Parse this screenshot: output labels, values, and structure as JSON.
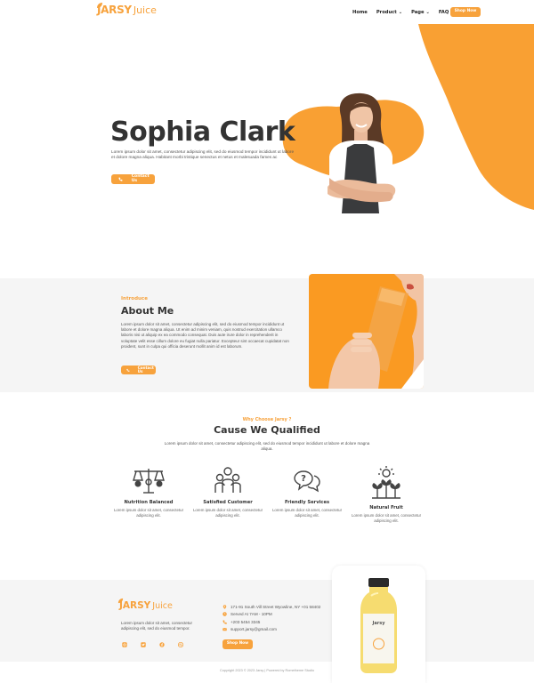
{
  "header": {
    "logo_bold": "JARSY",
    "logo_light": "Juice",
    "nav": [
      {
        "label": "Home",
        "dropdown": false
      },
      {
        "label": "Product",
        "dropdown": true
      },
      {
        "label": "Page",
        "dropdown": true
      },
      {
        "label": "FAQ",
        "dropdown": false
      }
    ],
    "shop_label": "Shop Now"
  },
  "hero": {
    "name": "Sophia Clark",
    "description": "Lorem ipsum dolor sit amet, consectetur adipiscing elit, sed do eiusmod tempor incididunt ut labore et dolore magna aliqua. Habitant morbi tristique senectus et netus et malesuada fames ac",
    "button_label": "Contact Us"
  },
  "about": {
    "label": "Introduce",
    "title": "About Me",
    "text": "Lorem ipsum dolor sit amet, consectetur adipiscing elit, sed do eiusmod tempor incididunt ut labore et dolore magna aliqua. Ut enim ad minim veniam, quis nostrud exercitation ullamco laboris nisi ut aliquip ex ea commodo consequat. Duis aute irure dolor in reprehenderit in voluptate velit esse cillum dolore eu fugiat nulla pariatur. Excepteur sint occaecat cupidatat non proident, sunt in culpa qui officia deserunt mollit anim id est laborum.",
    "button_label": "Contact Us"
  },
  "why": {
    "label": "Why Choose Jarsy ?",
    "title": "Cause We Qualified",
    "description": "Lorem ipsum dolor sit amet, consectetur adipiscing elit, sed do eiusmod tempor incididunt ut labore et dolore magna aliqua.",
    "features": [
      {
        "title": "Nutrition Balanced",
        "text": "Lorem ipsum dolor sit amet, consectetur adipiscing elit.",
        "icon": "nutrition-balance-icon"
      },
      {
        "title": "Satisfied Customer",
        "text": "Lorem ipsum dolor sit amet, consectetur adipiscing elit.",
        "icon": "satisfied-customer-icon"
      },
      {
        "title": "Friendly Services",
        "text": "Lorem ipsum dolor sit amet, consectetur adipiscing elit.",
        "icon": "friendly-services-icon"
      },
      {
        "title": "Natural Fruit",
        "text": "Lorem ipsum dolor sit amet, consectetur adipiscing elit.",
        "icon": "natural-fruit-icon"
      }
    ]
  },
  "footer": {
    "logo_bold": "JARSY",
    "logo_light": "Juice",
    "description": "Lorem ipsum dolor sit amet, consectetur adipiscing elit, sed do eiusmod tempor.",
    "social": [
      "instagram-icon",
      "twitter-icon",
      "facebook-icon",
      "dribbble-icon"
    ],
    "contact": [
      {
        "icon": "location-icon",
        "text": "171-91 South Vill Street Wyowline, NY +01 58402"
      },
      {
        "icon": "clock-icon",
        "text": "Served At 7AM - 10PM"
      },
      {
        "icon": "phone-icon",
        "text": "+203 5454 3345"
      },
      {
        "icon": "mail-icon",
        "text": "support.jarsy@gmail.com"
      }
    ],
    "shop_label": "Shop Now",
    "copyright": "Copyright 2023 © 2023 Jarsy | Powered by Rometheme Studio"
  },
  "colors": {
    "accent": "#f7a23c",
    "text": "#333333",
    "section_bg": "#f5f5f5"
  }
}
